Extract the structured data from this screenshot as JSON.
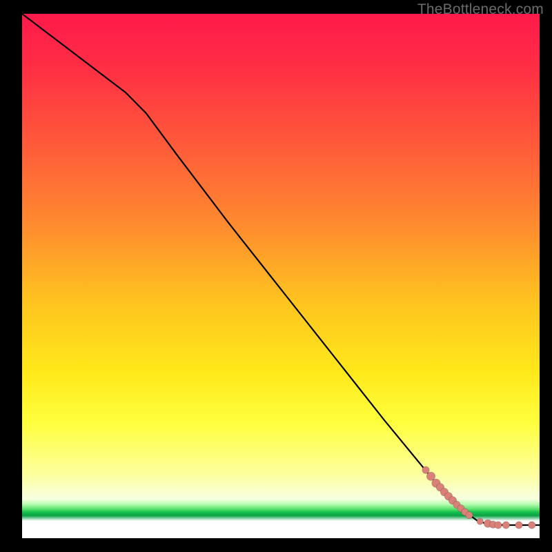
{
  "watermark": "TheBottleneck.com",
  "colors": {
    "dot": "#d98079",
    "curve": "#000000"
  },
  "chart_data": {
    "type": "line",
    "title": "",
    "xlabel": "",
    "ylabel": "",
    "xlim": [
      0,
      100
    ],
    "ylim": [
      0,
      100
    ],
    "grid": false,
    "curve": [
      {
        "x": 0,
        "y": 100.0
      },
      {
        "x": 10,
        "y": 92.5
      },
      {
        "x": 20,
        "y": 85.0
      },
      {
        "x": 24,
        "y": 81.0
      },
      {
        "x": 30,
        "y": 73.0
      },
      {
        "x": 40,
        "y": 60.0
      },
      {
        "x": 50,
        "y": 47.5
      },
      {
        "x": 60,
        "y": 35.0
      },
      {
        "x": 70,
        "y": 22.5
      },
      {
        "x": 80,
        "y": 10.5
      },
      {
        "x": 85,
        "y": 5.5
      },
      {
        "x": 88,
        "y": 3.3
      },
      {
        "x": 90,
        "y": 2.7
      },
      {
        "x": 93,
        "y": 2.5
      },
      {
        "x": 96,
        "y": 2.5
      },
      {
        "x": 100,
        "y": 2.5
      }
    ],
    "points": [
      {
        "x": 78.0,
        "y": 13.0,
        "r": 1.0
      },
      {
        "x": 79.0,
        "y": 11.8,
        "r": 1.2
      },
      {
        "x": 80.0,
        "y": 10.5,
        "r": 1.2
      },
      {
        "x": 80.8,
        "y": 9.7,
        "r": 1.1
      },
      {
        "x": 81.6,
        "y": 8.8,
        "r": 1.1
      },
      {
        "x": 82.4,
        "y": 8.0,
        "r": 1.1
      },
      {
        "x": 83.2,
        "y": 7.2,
        "r": 1.1
      },
      {
        "x": 84.0,
        "y": 6.4,
        "r": 1.0
      },
      {
        "x": 84.8,
        "y": 5.7,
        "r": 1.0
      },
      {
        "x": 85.6,
        "y": 5.0,
        "r": 1.0
      },
      {
        "x": 86.4,
        "y": 4.4,
        "r": 1.0
      },
      {
        "x": 88.5,
        "y": 3.2,
        "r": 0.9
      },
      {
        "x": 90.0,
        "y": 2.8,
        "r": 1.1
      },
      {
        "x": 91.0,
        "y": 2.6,
        "r": 1.0
      },
      {
        "x": 92.0,
        "y": 2.5,
        "r": 1.0
      },
      {
        "x": 93.5,
        "y": 2.5,
        "r": 1.0
      },
      {
        "x": 96.0,
        "y": 2.5,
        "r": 1.0
      },
      {
        "x": 98.5,
        "y": 2.5,
        "r": 1.0
      }
    ]
  }
}
